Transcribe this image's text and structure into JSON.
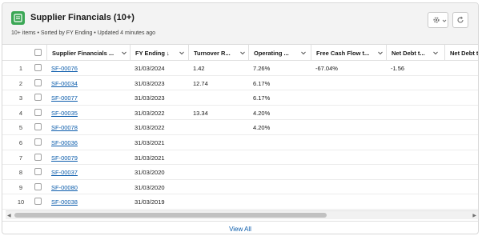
{
  "header": {
    "title": "Supplier Financials (10+)",
    "meta": "10+ items • Sorted by FY Ending • Updated 4 minutes ago",
    "settings_icon": "gear-icon",
    "refresh_icon": "refresh-icon",
    "object_icon": "supplier-financials-icon",
    "accent": "#3ba755"
  },
  "columns": [
    {
      "label": "Supplier Financials ...",
      "sort": ""
    },
    {
      "label": "FY Ending",
      "sort": "↓"
    },
    {
      "label": "Turnover R...",
      "sort": ""
    },
    {
      "label": "Operating ...",
      "sort": ""
    },
    {
      "label": "Free Cash Flow t...",
      "sort": ""
    },
    {
      "label": "Net Debt t...",
      "sort": ""
    },
    {
      "label": "Net Debt t",
      "sort": ""
    }
  ],
  "rows": [
    {
      "num": "1",
      "id": "SF-00076",
      "fy": "31/03/2024",
      "turnover": "1.42",
      "operating": "7.26%",
      "fcf": "-67.04%",
      "netdebt": "-1.56"
    },
    {
      "num": "2",
      "id": "SF-00034",
      "fy": "31/03/2023",
      "turnover": "12.74",
      "operating": "6.17%",
      "fcf": "",
      "netdebt": ""
    },
    {
      "num": "3",
      "id": "SF-00077",
      "fy": "31/03/2023",
      "turnover": "",
      "operating": "6.17%",
      "fcf": "",
      "netdebt": ""
    },
    {
      "num": "4",
      "id": "SF-00035",
      "fy": "31/03/2022",
      "turnover": "13.34",
      "operating": "4.20%",
      "fcf": "",
      "netdebt": ""
    },
    {
      "num": "5",
      "id": "SF-00078",
      "fy": "31/03/2022",
      "turnover": "",
      "operating": "4.20%",
      "fcf": "",
      "netdebt": ""
    },
    {
      "num": "6",
      "id": "SF-00036",
      "fy": "31/03/2021",
      "turnover": "",
      "operating": "",
      "fcf": "",
      "netdebt": ""
    },
    {
      "num": "7",
      "id": "SF-00079",
      "fy": "31/03/2021",
      "turnover": "",
      "operating": "",
      "fcf": "",
      "netdebt": ""
    },
    {
      "num": "8",
      "id": "SF-00037",
      "fy": "31/03/2020",
      "turnover": "",
      "operating": "",
      "fcf": "",
      "netdebt": ""
    },
    {
      "num": "9",
      "id": "SF-00080",
      "fy": "31/03/2020",
      "turnover": "",
      "operating": "",
      "fcf": "",
      "netdebt": ""
    },
    {
      "num": "10",
      "id": "SF-00038",
      "fy": "31/03/2019",
      "turnover": "",
      "operating": "",
      "fcf": "",
      "netdebt": ""
    }
  ],
  "footer": {
    "view_all": "View All"
  }
}
